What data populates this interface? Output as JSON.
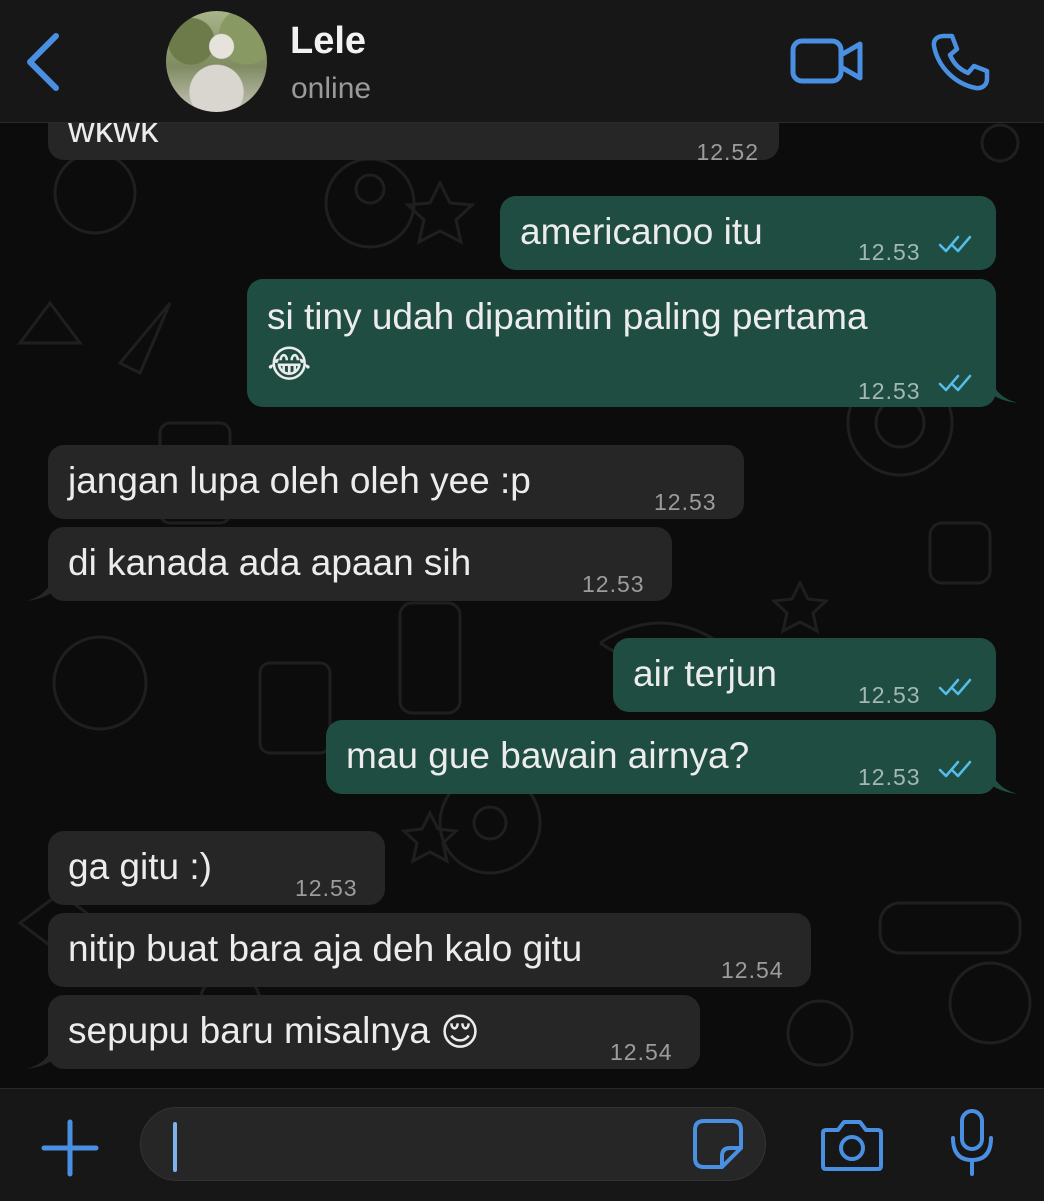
{
  "header": {
    "contact_name": "Lele",
    "status": "online"
  },
  "messages": [
    {
      "direction": "incoming",
      "text": "wkwk",
      "time": "12.52"
    },
    {
      "direction": "outgoing",
      "text": "americanoo itu",
      "time": "12.53",
      "status": "read"
    },
    {
      "direction": "outgoing",
      "text": "si tiny udah dipamitin paling pertama",
      "emoji": "😂",
      "time": "12.53",
      "status": "read"
    },
    {
      "direction": "incoming",
      "text": "jangan lupa oleh oleh yee :p",
      "time": "12.53"
    },
    {
      "direction": "incoming",
      "text": "di kanada ada apaan sih",
      "time": "12.53"
    },
    {
      "direction": "outgoing",
      "text": "air terjun",
      "time": "12.53",
      "status": "read"
    },
    {
      "direction": "outgoing",
      "text": "mau gue bawain airnya?",
      "time": "12.53",
      "status": "read"
    },
    {
      "direction": "incoming",
      "text": "ga gitu :)",
      "time": "12.53"
    },
    {
      "direction": "incoming",
      "text": "nitip buat bara aja deh kalo gitu",
      "time": "12.54"
    },
    {
      "direction": "incoming",
      "text": "sepupu baru misalnya",
      "emoji": "😌",
      "time": "12.54"
    }
  ],
  "icons": {
    "back": "chevron-left-icon",
    "video": "video-camera-icon",
    "call": "phone-icon",
    "attach": "plus-icon",
    "sticker": "sticker-icon",
    "camera": "camera-icon",
    "mic": "microphone-icon",
    "read_receipt": "double-check-icon"
  },
  "colors": {
    "accent": "#4a90e2",
    "outgoing_bubble": "#1f4d42",
    "incoming_bubble": "#262626",
    "read_ticks": "#53bdeb"
  }
}
